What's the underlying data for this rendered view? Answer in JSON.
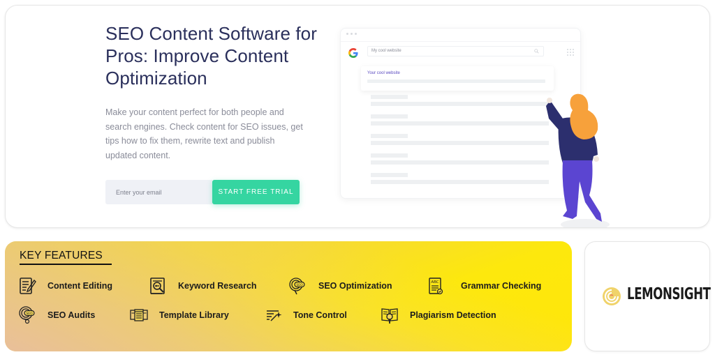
{
  "hero": {
    "title": "SEO Content Software for Pros: Improve Content Optimization",
    "description": "Make your content perfect for both people and search engines. Check content for SEO issues, get tips how to fix them, rewrite text and publish updated content.",
    "email_placeholder": "Enter your email",
    "cta_label": "START FREE TRIAL",
    "cta_color": "#35d5a1",
    "title_color": "#2a2f5b"
  },
  "illustration": {
    "search_query": "My cool website",
    "result_title": "Your cool website",
    "icons": [
      "google-logo-icon",
      "search-icon",
      "apps-grid-icon",
      "person-illustration"
    ]
  },
  "features": {
    "heading": "KEY FEATURES",
    "items": [
      {
        "label": "Content Editing",
        "icon": "document-pencil-icon"
      },
      {
        "label": "Keyword Research",
        "icon": "keyword-magnifier-icon"
      },
      {
        "label": "SEO Optimization",
        "icon": "seo-target-icon"
      },
      {
        "label": "Grammar Checking",
        "icon": "abc-document-check-icon"
      },
      {
        "label": "SEO Audits",
        "icon": "seo-audit-magnifier-icon"
      },
      {
        "label": "Template Library",
        "icon": "template-layout-icon"
      },
      {
        "label": "Tone Control",
        "icon": "tone-sparkle-lines-icon"
      },
      {
        "label": "Plagiarism Detection",
        "icon": "book-magnifier-icon"
      }
    ]
  },
  "brand": {
    "name": "LEMONSIGHT",
    "icon": "lemon-swirl-icon",
    "icon_color": "#f0d36a"
  }
}
